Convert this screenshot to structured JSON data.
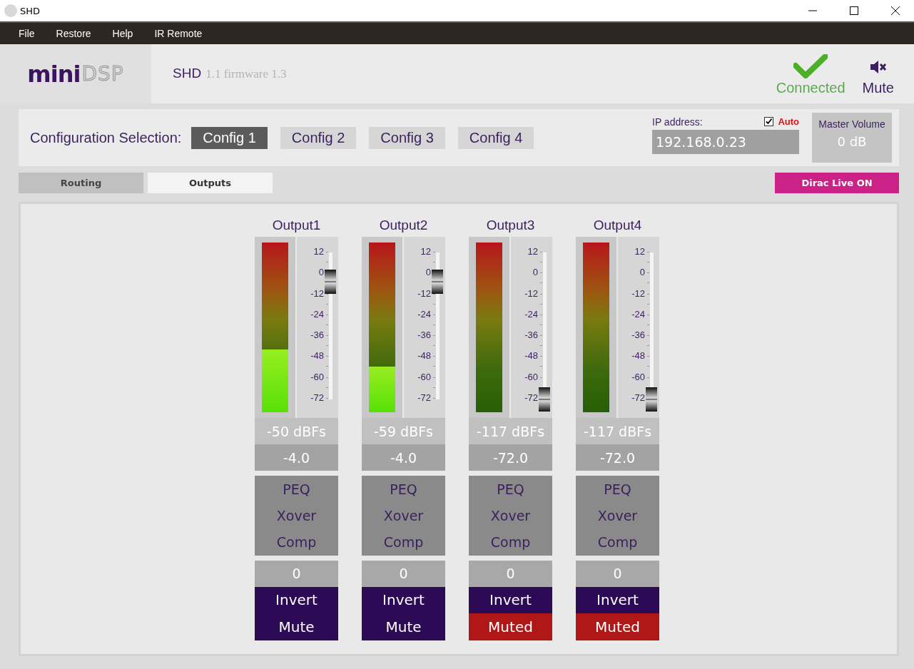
{
  "window": {
    "title": "SHD"
  },
  "menu": [
    "File",
    "Restore",
    "Help",
    "IR Remote"
  ],
  "logo": {
    "part_1": "mini",
    "part_2": "DSP"
  },
  "product": {
    "name": "SHD",
    "version": "1.1 firmware 1.3"
  },
  "status": {
    "connection": "Connected",
    "mute": "Mute"
  },
  "config": {
    "label": "Configuration Selection:",
    "options": [
      {
        "label": "Config 1",
        "selected": true
      },
      {
        "label": "Config 2",
        "selected": false
      },
      {
        "label": "Config 3",
        "selected": false
      },
      {
        "label": "Config 4",
        "selected": false
      }
    ],
    "ip_label": "IP address:",
    "auto_checked": true,
    "auto_label": "Auto",
    "ip_value": "192.168.0.23",
    "master_volume_label": "Master Volume",
    "master_volume": "0 dB"
  },
  "tabs": [
    {
      "label": "Routing",
      "selected": false
    },
    {
      "label": "Outputs",
      "selected": true
    }
  ],
  "dirac_button": "Dirac Live ON",
  "outputs": [
    {
      "name": "Output1",
      "meter": {
        "level": 0.37
      },
      "fader": {
        "level": 0.8
      },
      "scale": [
        "12",
        "0",
        "-12",
        "-24",
        "-36",
        "-48",
        "-60",
        "-72"
      ],
      "reading": "-50 dBFs",
      "gain": "-4.0",
      "filters": [
        "PEQ",
        "Xover",
        "Comp"
      ],
      "delay": "0",
      "invert": "Invert",
      "mute_label": "Mute",
      "muted": false
    },
    {
      "name": "Output2",
      "meter": {
        "level": 0.27
      },
      "fader": {
        "level": 0.8
      },
      "scale": [
        "12",
        "0",
        "-12",
        "-24",
        "-36",
        "-48",
        "-60",
        "-72"
      ],
      "reading": "-59 dBFs",
      "gain": "-4.0",
      "filters": [
        "PEQ",
        "Xover",
        "Comp"
      ],
      "delay": "0",
      "invert": "Invert",
      "mute_label": "Mute",
      "muted": false
    },
    {
      "name": "Output3",
      "meter": {
        "level": 0
      },
      "fader": {
        "level": 0
      },
      "scale": [
        "12",
        "0",
        "-12",
        "-24",
        "-36",
        "-48",
        "-60",
        "-72"
      ],
      "reading": "-117 dBFs",
      "gain": "-72.0",
      "filters": [
        "PEQ",
        "Xover",
        "Comp"
      ],
      "delay": "0",
      "invert": "Invert",
      "mute_label": "Muted",
      "muted": true
    },
    {
      "name": "Output4",
      "meter": {
        "level": 0
      },
      "fader": {
        "level": 0
      },
      "scale": [
        "12",
        "0",
        "-12",
        "-24",
        "-36",
        "-48",
        "-60",
        "-72"
      ],
      "reading": "-117 dBFs",
      "gain": "-72.0",
      "filters": [
        "PEQ",
        "Xover",
        "Comp"
      ],
      "delay": "0",
      "invert": "Invert",
      "mute_label": "Muted",
      "muted": true
    }
  ]
}
